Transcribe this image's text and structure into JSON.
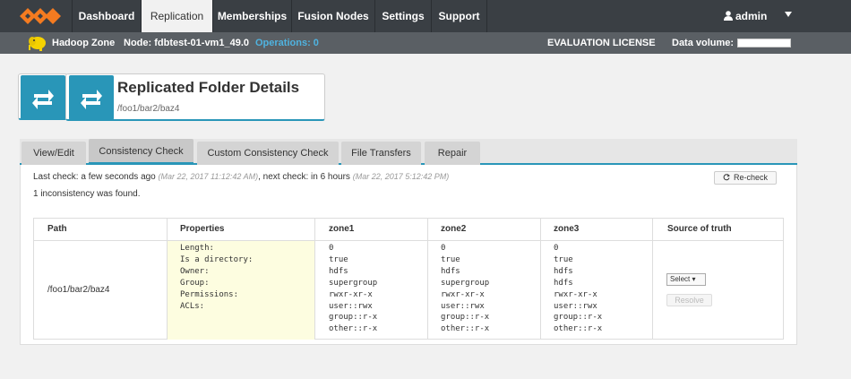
{
  "nav": {
    "items": [
      {
        "label": "Dashboard"
      },
      {
        "label": "Replication"
      },
      {
        "label": "Memberships"
      },
      {
        "label": "Fusion Nodes"
      },
      {
        "label": "Settings"
      },
      {
        "label": "Support"
      }
    ],
    "active": "Replication",
    "user": "admin"
  },
  "subbar": {
    "zone": "Hadoop Zone",
    "node": "Node: fdbtest-01-vm1_49.0",
    "operations": "Operations: 0",
    "license": "EVALUATION LICENSE",
    "data_volume_label": "Data volume:"
  },
  "header": {
    "title": "Replicated Folder Details",
    "path": "/foo1/bar2/baz4"
  },
  "tabs": [
    {
      "label": "View/Edit"
    },
    {
      "label": "Consistency Check"
    },
    {
      "label": "Custom Consistency Check"
    },
    {
      "label": "File Transfers"
    },
    {
      "label": "Repair"
    }
  ],
  "check": {
    "last_prefix": "Last check: a few seconds ago",
    "last_ts": "(Mar 22, 2017 11:12:42 AM)",
    "next_prefix": ", next check: in 6 hours",
    "next_ts": "(Mar 22, 2017 5:12:42 PM)",
    "result": "1 inconsistency was found.",
    "recheck_label": "Re-check"
  },
  "table": {
    "headers": [
      "Path",
      "Properties",
      "zone1",
      "zone2",
      "zone3",
      "Source of truth"
    ],
    "path": "/foo1/bar2/baz4",
    "properties": "Length:\nIs a directory:\nOwner:\nGroup:\nPermissions:\nACLs:",
    "zone1": "0\ntrue\nhdfs\nsupergroup\nrwxr-xr-x\nuser::rwx\ngroup::r-x\nother::r-x",
    "zone2": "0\ntrue\nhdfs\nsupergroup\nrwxr-xr-x\nuser::rwx\ngroup::r-x\nother::r-x",
    "zone3": "0\ntrue\nhdfs\nhdfs\nrwxr-xr-x\nuser::rwx\ngroup::r-x\nother::r-x",
    "select_label": "Select",
    "resolve_label": "Resolve"
  },
  "colors": {
    "accent": "#2996b8",
    "nav_bg": "#3a3f44",
    "logo": "#f47b20",
    "operations": "#4fb3e0"
  }
}
